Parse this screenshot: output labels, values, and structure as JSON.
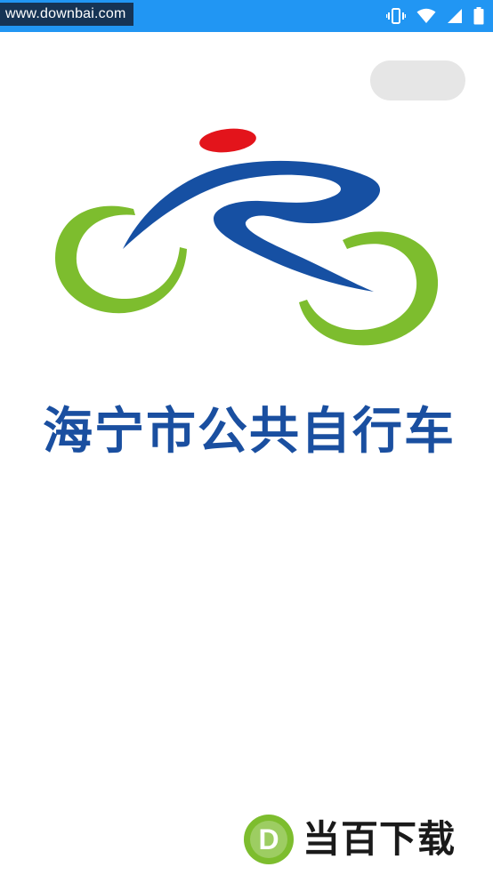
{
  "status_bar": {
    "watermark_url": "www.downbai.com",
    "icons": [
      "vibrate-icon",
      "wifi-icon",
      "signal-icon",
      "battery-icon"
    ],
    "background_color": "#2196f3"
  },
  "skip_button": {
    "label": ""
  },
  "brand": {
    "title": "海宁市公共自行车",
    "title_color": "#1a4fa0",
    "logo_colors": {
      "head": "#e3141b",
      "body": "#1650a3",
      "wheels": "#7dbd2e"
    }
  },
  "watermark": {
    "badge_letter": "D",
    "text": "当百下载"
  }
}
